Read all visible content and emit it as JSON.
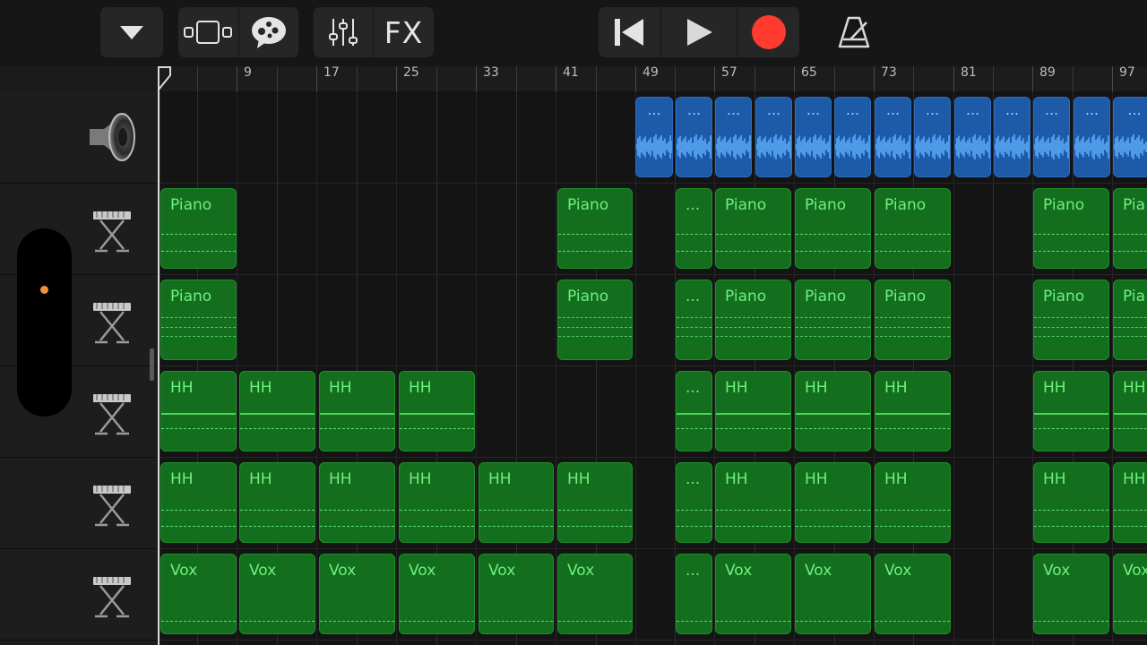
{
  "toolbar": {
    "browser_toggle_icon": "triangle-down-icon",
    "view_toggle_icon": "tracks-view-icon",
    "loops_icon": "speech-bubble-icon",
    "mixer_icon": "sliders-icon",
    "fx_label": "FX",
    "rewind_icon": "skip-back-icon",
    "play_icon": "play-icon",
    "record_icon": "record-icon",
    "metronome_icon": "metronome-icon",
    "record_color": "#ff3b30"
  },
  "ruler": {
    "bar_numbers": [
      "9",
      "17",
      "25",
      "33",
      "41",
      "49",
      "57",
      "65",
      "73",
      "81",
      "89",
      "97"
    ]
  },
  "tracks": [
    {
      "icon": "speaker-icon",
      "kind": "audio"
    },
    {
      "icon": "keyboard-icon",
      "kind": "midi"
    },
    {
      "icon": "keyboard-icon",
      "kind": "midi"
    },
    {
      "icon": "keyboard-icon",
      "kind": "midi"
    },
    {
      "icon": "keyboard-icon",
      "kind": "midi"
    },
    {
      "icon": "keyboard-icon",
      "kind": "midi"
    }
  ],
  "regions": {
    "audio": [
      "...",
      "...",
      "...",
      "...",
      "...",
      "...",
      "...",
      "...",
      "...",
      "...",
      "...",
      "...",
      "..."
    ],
    "piano1": [
      "Piano",
      "Piano",
      "...",
      "Piano",
      "Piano",
      "Piano",
      "Piano",
      "Pia"
    ],
    "piano2": [
      "Piano",
      "Piano",
      "...",
      "Piano",
      "Piano",
      "Piano",
      "Piano",
      "Pia"
    ],
    "hh1": [
      "HH",
      "HH",
      "HH",
      "HH",
      "...",
      "HH",
      "HH",
      "HH",
      "HH",
      "HH"
    ],
    "hh2": [
      "HH",
      "HH",
      "HH",
      "HH",
      "HH",
      "HH",
      "...",
      "HH",
      "HH",
      "HH",
      "HH",
      "HH"
    ],
    "vox": [
      "Vox",
      "Vox",
      "Vox",
      "Vox",
      "Vox",
      "Vox",
      "...",
      "Vox",
      "Vox",
      "Vox",
      "Vox",
      "Vox"
    ]
  },
  "colors": {
    "midi_region": "#136e1e",
    "midi_text": "#6ff07d",
    "audio_region": "#1d5aa8",
    "accent": "#f0903a"
  }
}
